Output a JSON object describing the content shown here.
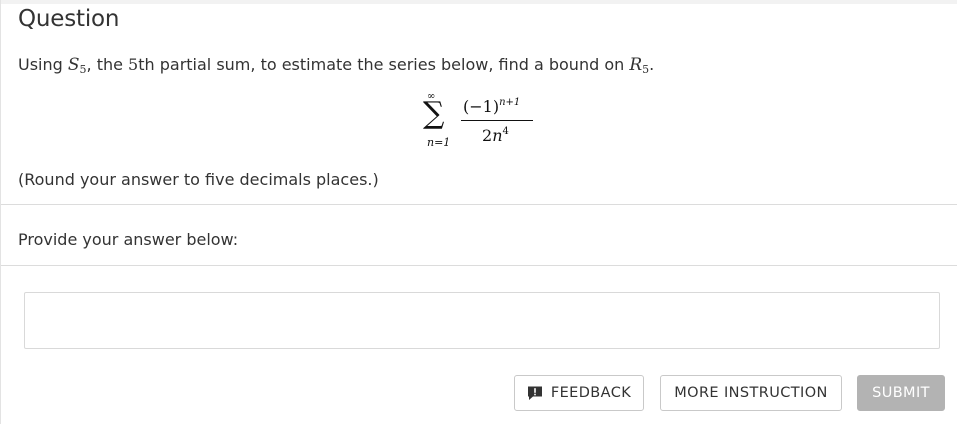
{
  "header": {
    "title": "Question"
  },
  "question": {
    "prompt_before": "Using ",
    "s_symbol": "S",
    "s_sub": "5",
    "prompt_middle": ", the ",
    "nth_number": "5",
    "prompt_after": "th partial sum, to estimate the series below, find a bound on ",
    "r_symbol": "R",
    "r_sub": "5",
    "prompt_end": ".",
    "formula": {
      "upper_limit": "∞",
      "sigma": "∑",
      "lower_limit": "n=1",
      "numerator_base": "(−1)",
      "numerator_exp": "n+1",
      "denominator_coef": "2",
      "denominator_var": "n",
      "denominator_exp": "4"
    },
    "instruction": "(Round your answer to five decimals places.)"
  },
  "answer": {
    "label": "Provide your answer below:",
    "value": ""
  },
  "buttons": {
    "feedback_label": "FEEDBACK",
    "feedback_icon": "feedback-speech-bubble-icon",
    "more_instruction_label": "MORE INSTRUCTION",
    "submit_label": "SUBMIT"
  },
  "colors": {
    "text": "#333333",
    "submit_disabled_bg": "#b3b3b3",
    "border": "#d9d9d9"
  }
}
